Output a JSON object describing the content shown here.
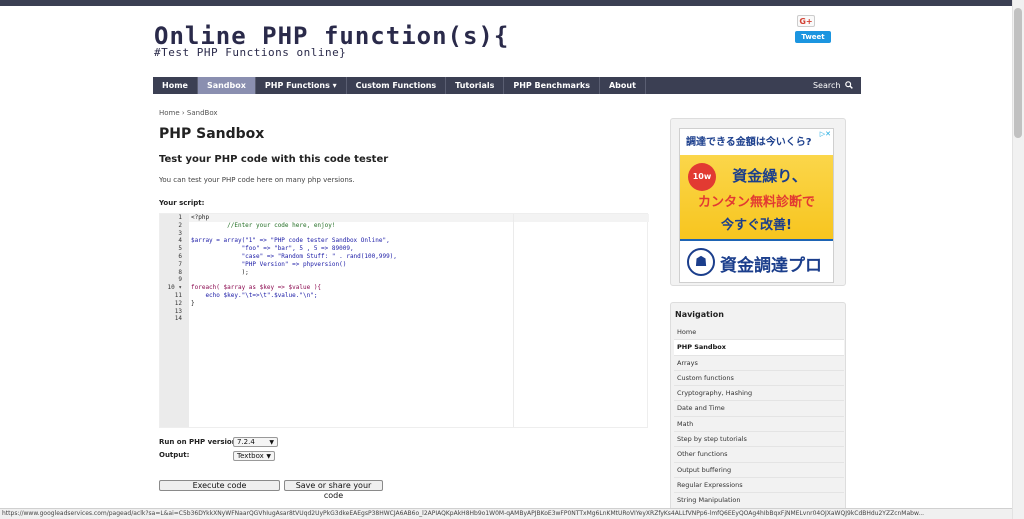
{
  "site": {
    "title": "Online PHP function(s){",
    "subtitle": "#Test PHP Functions online}",
    "gplus_label": "G+",
    "tweet_label": "Tweet"
  },
  "nav": {
    "items": [
      {
        "label": "Home",
        "active": false
      },
      {
        "label": "Sandbox",
        "active": true
      },
      {
        "label": "PHP Functions ▾",
        "active": false
      },
      {
        "label": "Custom Functions",
        "active": false
      },
      {
        "label": "Tutorials",
        "active": false
      },
      {
        "label": "PHP Benchmarks",
        "active": false
      },
      {
        "label": "About",
        "active": false
      }
    ],
    "search_label": "Search"
  },
  "main": {
    "breadcrumb": "Home › SandBox",
    "title": "PHP Sandbox",
    "subtitle": "Test your PHP code with this code tester",
    "description": "You can test your PHP code here on many php versions.",
    "script_label": "Your script:",
    "editor": {
      "line_numbers": [
        "1",
        "2",
        "3",
        "4",
        "5",
        "6",
        "7",
        "8",
        "9",
        "10 ▾",
        "11",
        "12",
        "13",
        "14"
      ],
      "lines": [
        "<?php",
        "          //Enter your code here, enjoy!",
        "",
        "$array = array(\"1\" => \"PHP code tester Sandbox Online\",",
        "              \"foo\" => \"bar\", 5 , 5 => 89009,",
        "              \"case\" => \"Random Stuff: \" . rand(100,999),",
        "              \"PHP Version\" => phpversion()",
        "              );",
        "",
        "foreach( $array as $key => $value ){",
        "    echo $key.\"\\t=>\\t\".$value.\"\\n\";",
        "}",
        "",
        ""
      ]
    },
    "php_version_label": "Run on PHP version:",
    "php_version_value": "7.2.4",
    "output_label": "Output:",
    "output_value": "Textbox",
    "execute_button": "Execute code",
    "save_button": "Save or share your code"
  },
  "ad": {
    "top_text": "調達できる金額は今いくら?",
    "badge": "10w",
    "line1": "資金繰り、",
    "line2": "カンタン無料診断で",
    "line3": "今すぐ改善!",
    "brand": "資金調達プロ",
    "adchoices": "▷✕"
  },
  "sidebar": {
    "title": "Navigation",
    "items": [
      {
        "label": "Home",
        "current": false
      },
      {
        "label": "PHP Sandbox",
        "current": true
      },
      {
        "label": "Arrays",
        "current": false
      },
      {
        "label": "Custom functions",
        "current": false
      },
      {
        "label": "Cryptography, Hashing",
        "current": false
      },
      {
        "label": "Date and Time",
        "current": false
      },
      {
        "label": "Math",
        "current": false
      },
      {
        "label": "Step by step tutorials",
        "current": false
      },
      {
        "label": "Other functions",
        "current": false
      },
      {
        "label": "Output buffering",
        "current": false
      },
      {
        "label": "Regular Expressions",
        "current": false
      },
      {
        "label": "String Manipulation",
        "current": false
      }
    ]
  },
  "status_url": "https://www.googleadservices.com/pagead/aclk?sa=L&ai=C5b36DYkkXNyWFNaarQGVhIugAsar8tVUqd2UyPkG3dkeEAEgsP38HWCJA6AB6o_l2APIAQKpAkH8Hb9o1W0M-qAMByAPJBKoE3wFP0NTTxMg6LnKMtURoVIYeyXRZfyKs4ALLfVNPp6-lmfQ6EEyQOAg4hIbBqxFjNMELvnr04OJXaWQJ9kCdBHdu2YZZcnMabw..."
}
